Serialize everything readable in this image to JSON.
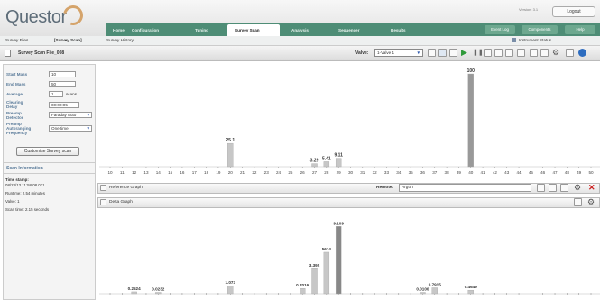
{
  "app": {
    "logo_text": "Questor",
    "version": "Version: 3.1",
    "logout": "Logout"
  },
  "nav": {
    "tabs": [
      "Home",
      "Configuration",
      "Tuning",
      "Survey Scan",
      "Analysis",
      "Sequencer",
      "Results"
    ],
    "active_tab": "Survey Scan",
    "right_buttons": [
      "Event Log",
      "Components",
      "Help"
    ]
  },
  "subnav": {
    "items": [
      "Survey Files",
      "[Survey Scan]",
      "Survey History"
    ],
    "instrument_status": "Instrument Status"
  },
  "titlebar": {
    "title": "Survey Scan File_008",
    "valve_label": "Valve:",
    "valve_value": "1-Valve 1"
  },
  "form": {
    "start_mass": {
      "label": "Start Mass",
      "value": "10"
    },
    "end_mass": {
      "label": "End Mass",
      "value": "50"
    },
    "average": {
      "label": "Average",
      "value": "1",
      "unit": "scans"
    },
    "clearing_delay": {
      "label1": "Clearing",
      "label2": "Delay",
      "value": "00:00:05"
    },
    "preamp_detector": {
      "label1": "Preamp",
      "label2": "Detector",
      "value": "Faraday Auto"
    },
    "preamp_autoranging": {
      "label1": "Preamp",
      "label2": "Autoranging",
      "label3": "Frequency",
      "value": "One time"
    },
    "customise_button": "Customise Survey scan"
  },
  "scan_info": {
    "heading": "Scan Information",
    "time_stamp_label": "Time stamp:",
    "time_stamp_value": "08/23/13 11:58:08.031",
    "runtime": "Runtime: 2.54 minutes",
    "valve": "Valve: 1",
    "scan_time": "Scan time: 2.15 seconds"
  },
  "reference_graph": {
    "label": "Reference Graph",
    "remote_label": "Remote:",
    "remote_value": "Argon"
  },
  "delta_graph": {
    "label": "Delta Graph"
  },
  "chart_data": [
    {
      "type": "bar",
      "name": "Reference Graph",
      "x_ticks": [
        10,
        11,
        12,
        13,
        14,
        15,
        16,
        17,
        18,
        19,
        20,
        21,
        22,
        23,
        24,
        25,
        26,
        27,
        28,
        29,
        30,
        31,
        32,
        33,
        34,
        35,
        36,
        37,
        38,
        39,
        40,
        41,
        42,
        43,
        44,
        45,
        46,
        47,
        48,
        49,
        50
      ],
      "points": [
        {
          "x": 20,
          "y": 25.1,
          "label": "25.1"
        },
        {
          "x": 27,
          "y": 3.29,
          "label": "3.29"
        },
        {
          "x": 28,
          "y": 5.41,
          "label": "5.41"
        },
        {
          "x": 29,
          "y": 9.11,
          "label": "9.11"
        },
        {
          "x": 40,
          "y": 100,
          "label": "100"
        }
      ],
      "ylim": [
        0,
        100
      ]
    },
    {
      "type": "bar",
      "name": "Delta Graph",
      "points": [
        {
          "x": 12,
          "y": 0.2524,
          "label": "0.2524"
        },
        {
          "x": 14,
          "y": 0.0232,
          "label": "0.0232"
        },
        {
          "x": 20,
          "y": 1.073,
          "label": "1.073"
        },
        {
          "x": 26,
          "y": 0.7016,
          "label": "0.7016"
        },
        {
          "x": 27,
          "y": 3.392,
          "label": "3.392"
        },
        {
          "x": 28,
          "y": 5.614,
          "label": "5614"
        },
        {
          "x": 29,
          "y": 9.109,
          "label": "9.109"
        },
        {
          "x": 36,
          "y": 0.01,
          "label": "0.0100"
        },
        {
          "x": 37,
          "y": 0.7915,
          "label": "0.7915"
        },
        {
          "x": 40,
          "y": 0.4649,
          "label": "0.4649"
        }
      ],
      "ylim": [
        0,
        10
      ]
    }
  ],
  "colors": {
    "nav": "#4e8d76",
    "bar": "#c7c7c7",
    "bar_dark": "#999999",
    "accent_label": "#5a7b9a"
  }
}
